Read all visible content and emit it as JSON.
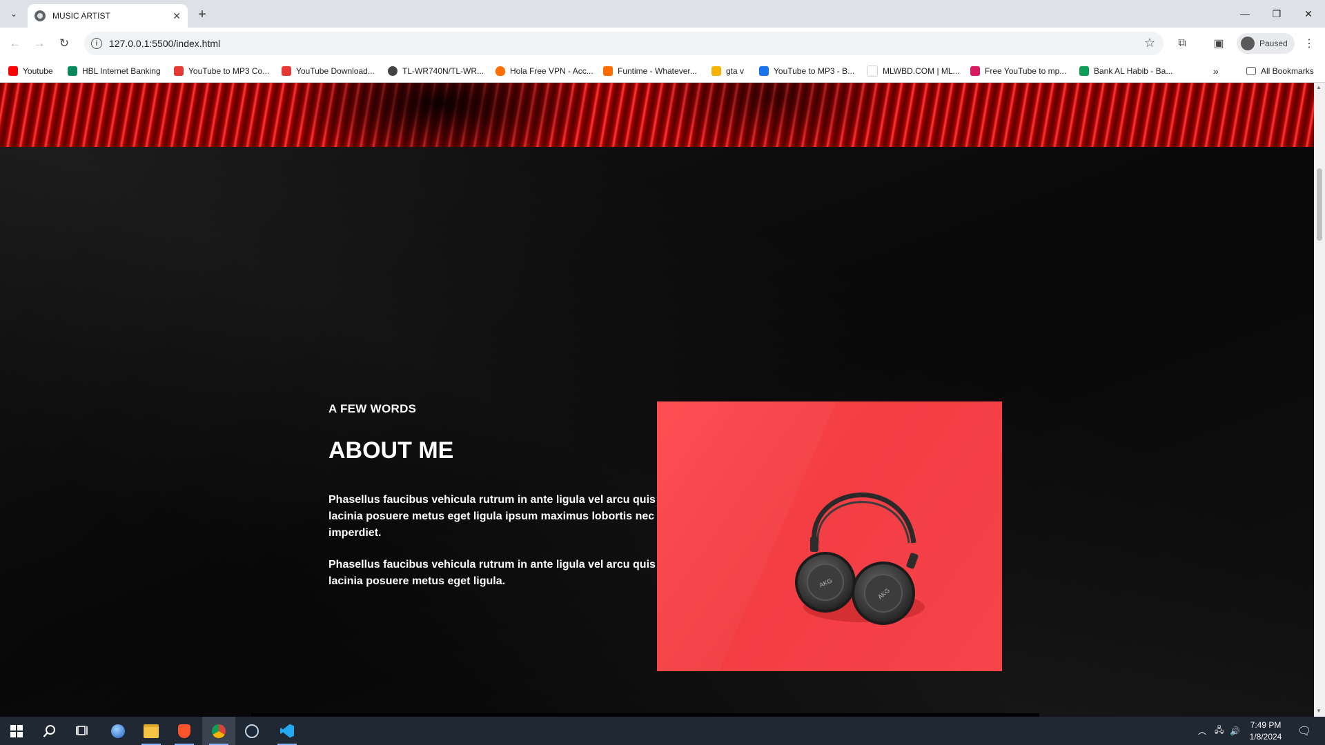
{
  "browser": {
    "tab_title": "MUSIC ARTIST",
    "url": "127.0.0.1:5500/index.html",
    "profile_label": "Paused",
    "bookmarks": [
      {
        "label": "Youtube",
        "color": "#ff0000"
      },
      {
        "label": "HBL Internet Banking",
        "color": "#0a8a5c"
      },
      {
        "label": "YouTube to MP3 Co...",
        "color": "#e53935"
      },
      {
        "label": "YouTube Download...",
        "color": "#e53935"
      },
      {
        "label": "TL-WR740N/TL-WR...",
        "color": "#444444"
      },
      {
        "label": "Hola Free VPN - Acc...",
        "color": "#ff6d00"
      },
      {
        "label": "Funtime - Whatever...",
        "color": "#ff6d00"
      },
      {
        "label": "gta v",
        "color": "#f4b400"
      },
      {
        "label": "YouTube to MP3 - B...",
        "color": "#1a73e8"
      },
      {
        "label": "MLWBD.COM | ML...",
        "color": "#e0e0e0"
      },
      {
        "label": "Free YouTube to mp...",
        "color": "#d81b60"
      },
      {
        "label": "Bank AL Habib - Ba...",
        "color": "#0f9d58"
      }
    ],
    "all_bookmarks_label": "All Bookmarks"
  },
  "page": {
    "eyebrow": "A FEW WORDS",
    "heading": "ABOUT ME",
    "paragraph1": "Phasellus faucibus vehicula rutrum in ante ligula vel arcu quis lacinia posuere metus eget ligula ipsum maximus lobortis nec imperdiet.",
    "paragraph2": "Phasellus faucibus vehicula rutrum in ante ligula vel arcu quis lacinia posuere metus eget ligula.",
    "headphone_brand": "AKG",
    "accent_color": "#f23d43"
  },
  "taskbar": {
    "time": "7:49 PM",
    "date": "1/8/2024"
  }
}
